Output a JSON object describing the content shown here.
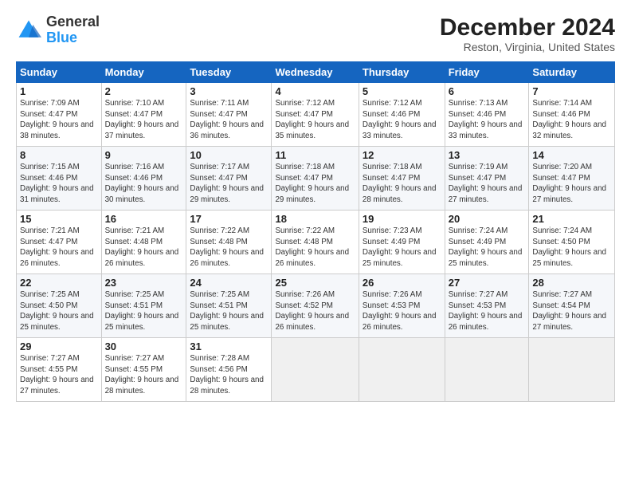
{
  "logo": {
    "general": "General",
    "blue": "Blue"
  },
  "header": {
    "title": "December 2024",
    "subtitle": "Reston, Virginia, United States"
  },
  "calendar": {
    "days_of_week": [
      "Sunday",
      "Monday",
      "Tuesday",
      "Wednesday",
      "Thursday",
      "Friday",
      "Saturday"
    ],
    "weeks": [
      [
        {
          "day": "1",
          "sunrise": "Sunrise: 7:09 AM",
          "sunset": "Sunset: 4:47 PM",
          "daylight": "Daylight: 9 hours and 38 minutes."
        },
        {
          "day": "2",
          "sunrise": "Sunrise: 7:10 AM",
          "sunset": "Sunset: 4:47 PM",
          "daylight": "Daylight: 9 hours and 37 minutes."
        },
        {
          "day": "3",
          "sunrise": "Sunrise: 7:11 AM",
          "sunset": "Sunset: 4:47 PM",
          "daylight": "Daylight: 9 hours and 36 minutes."
        },
        {
          "day": "4",
          "sunrise": "Sunrise: 7:12 AM",
          "sunset": "Sunset: 4:47 PM",
          "daylight": "Daylight: 9 hours and 35 minutes."
        },
        {
          "day": "5",
          "sunrise": "Sunrise: 7:12 AM",
          "sunset": "Sunset: 4:46 PM",
          "daylight": "Daylight: 9 hours and 33 minutes."
        },
        {
          "day": "6",
          "sunrise": "Sunrise: 7:13 AM",
          "sunset": "Sunset: 4:46 PM",
          "daylight": "Daylight: 9 hours and 33 minutes."
        },
        {
          "day": "7",
          "sunrise": "Sunrise: 7:14 AM",
          "sunset": "Sunset: 4:46 PM",
          "daylight": "Daylight: 9 hours and 32 minutes."
        }
      ],
      [
        {
          "day": "8",
          "sunrise": "Sunrise: 7:15 AM",
          "sunset": "Sunset: 4:46 PM",
          "daylight": "Daylight: 9 hours and 31 minutes."
        },
        {
          "day": "9",
          "sunrise": "Sunrise: 7:16 AM",
          "sunset": "Sunset: 4:46 PM",
          "daylight": "Daylight: 9 hours and 30 minutes."
        },
        {
          "day": "10",
          "sunrise": "Sunrise: 7:17 AM",
          "sunset": "Sunset: 4:47 PM",
          "daylight": "Daylight: 9 hours and 29 minutes."
        },
        {
          "day": "11",
          "sunrise": "Sunrise: 7:18 AM",
          "sunset": "Sunset: 4:47 PM",
          "daylight": "Daylight: 9 hours and 29 minutes."
        },
        {
          "day": "12",
          "sunrise": "Sunrise: 7:18 AM",
          "sunset": "Sunset: 4:47 PM",
          "daylight": "Daylight: 9 hours and 28 minutes."
        },
        {
          "day": "13",
          "sunrise": "Sunrise: 7:19 AM",
          "sunset": "Sunset: 4:47 PM",
          "daylight": "Daylight: 9 hours and 27 minutes."
        },
        {
          "day": "14",
          "sunrise": "Sunrise: 7:20 AM",
          "sunset": "Sunset: 4:47 PM",
          "daylight": "Daylight: 9 hours and 27 minutes."
        }
      ],
      [
        {
          "day": "15",
          "sunrise": "Sunrise: 7:21 AM",
          "sunset": "Sunset: 4:47 PM",
          "daylight": "Daylight: 9 hours and 26 minutes."
        },
        {
          "day": "16",
          "sunrise": "Sunrise: 7:21 AM",
          "sunset": "Sunset: 4:48 PM",
          "daylight": "Daylight: 9 hours and 26 minutes."
        },
        {
          "day": "17",
          "sunrise": "Sunrise: 7:22 AM",
          "sunset": "Sunset: 4:48 PM",
          "daylight": "Daylight: 9 hours and 26 minutes."
        },
        {
          "day": "18",
          "sunrise": "Sunrise: 7:22 AM",
          "sunset": "Sunset: 4:48 PM",
          "daylight": "Daylight: 9 hours and 26 minutes."
        },
        {
          "day": "19",
          "sunrise": "Sunrise: 7:23 AM",
          "sunset": "Sunset: 4:49 PM",
          "daylight": "Daylight: 9 hours and 25 minutes."
        },
        {
          "day": "20",
          "sunrise": "Sunrise: 7:24 AM",
          "sunset": "Sunset: 4:49 PM",
          "daylight": "Daylight: 9 hours and 25 minutes."
        },
        {
          "day": "21",
          "sunrise": "Sunrise: 7:24 AM",
          "sunset": "Sunset: 4:50 PM",
          "daylight": "Daylight: 9 hours and 25 minutes."
        }
      ],
      [
        {
          "day": "22",
          "sunrise": "Sunrise: 7:25 AM",
          "sunset": "Sunset: 4:50 PM",
          "daylight": "Daylight: 9 hours and 25 minutes."
        },
        {
          "day": "23",
          "sunrise": "Sunrise: 7:25 AM",
          "sunset": "Sunset: 4:51 PM",
          "daylight": "Daylight: 9 hours and 25 minutes."
        },
        {
          "day": "24",
          "sunrise": "Sunrise: 7:25 AM",
          "sunset": "Sunset: 4:51 PM",
          "daylight": "Daylight: 9 hours and 25 minutes."
        },
        {
          "day": "25",
          "sunrise": "Sunrise: 7:26 AM",
          "sunset": "Sunset: 4:52 PM",
          "daylight": "Daylight: 9 hours and 26 minutes."
        },
        {
          "day": "26",
          "sunrise": "Sunrise: 7:26 AM",
          "sunset": "Sunset: 4:53 PM",
          "daylight": "Daylight: 9 hours and 26 minutes."
        },
        {
          "day": "27",
          "sunrise": "Sunrise: 7:27 AM",
          "sunset": "Sunset: 4:53 PM",
          "daylight": "Daylight: 9 hours and 26 minutes."
        },
        {
          "day": "28",
          "sunrise": "Sunrise: 7:27 AM",
          "sunset": "Sunset: 4:54 PM",
          "daylight": "Daylight: 9 hours and 27 minutes."
        }
      ],
      [
        {
          "day": "29",
          "sunrise": "Sunrise: 7:27 AM",
          "sunset": "Sunset: 4:55 PM",
          "daylight": "Daylight: 9 hours and 27 minutes."
        },
        {
          "day": "30",
          "sunrise": "Sunrise: 7:27 AM",
          "sunset": "Sunset: 4:55 PM",
          "daylight": "Daylight: 9 hours and 28 minutes."
        },
        {
          "day": "31",
          "sunrise": "Sunrise: 7:28 AM",
          "sunset": "Sunset: 4:56 PM",
          "daylight": "Daylight: 9 hours and 28 minutes."
        },
        null,
        null,
        null,
        null
      ]
    ]
  }
}
